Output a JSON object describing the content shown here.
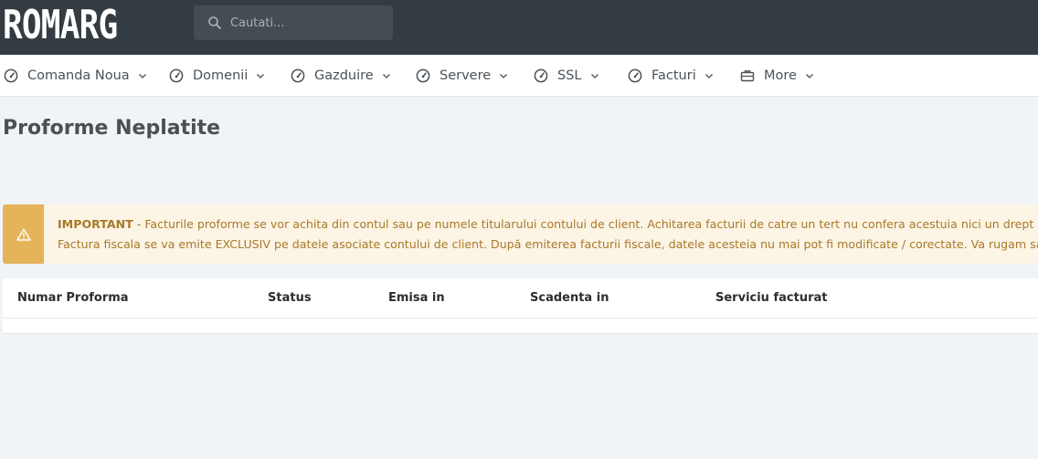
{
  "brand": {
    "logo_text": "ROMARG"
  },
  "search": {
    "placeholder": "Cautati..."
  },
  "nav": {
    "items": [
      {
        "label": "Comanda Noua",
        "icon": "dashboard-gauge-icon"
      },
      {
        "label": "Domenii",
        "icon": "dashboard-gauge-icon"
      },
      {
        "label": "Gazduire",
        "icon": "dashboard-gauge-icon"
      },
      {
        "label": "Servere",
        "icon": "dashboard-gauge-icon"
      },
      {
        "label": "SSL",
        "icon": "dashboard-gauge-icon"
      },
      {
        "label": "Facturi",
        "icon": "dashboard-gauge-icon"
      },
      {
        "label": "More",
        "icon": "briefcase-icon"
      }
    ]
  },
  "page": {
    "title": "Proforme Neplatite"
  },
  "alert": {
    "icon": "warning-triangle-icon",
    "strong": "IMPORTANT",
    "line1_rest": " - Facturile proforme se vor achita din contul sau pe numele titularului contului de client. Achitarea facturii de catre un tert nu confera acestuia nici un drept asupra",
    "line2": "Factura fiscala se va emite EXCLUSIV pe datele asociate contului de client. După emiterea facturii fiscale, datele acesteia nu mai pot fi modificate / corectate. Va rugam sa verific"
  },
  "table": {
    "columns": [
      "Numar Proforma",
      "Status",
      "Emisa in",
      "Scadenta in",
      "Serviciu facturat"
    ],
    "rows": []
  },
  "colors": {
    "topbar": "#323c42",
    "accent_warning": "#e5b35a",
    "alert_bg": "#fcf4e4",
    "alert_text": "#a8792a",
    "page_bg": "#f0f4f7"
  }
}
